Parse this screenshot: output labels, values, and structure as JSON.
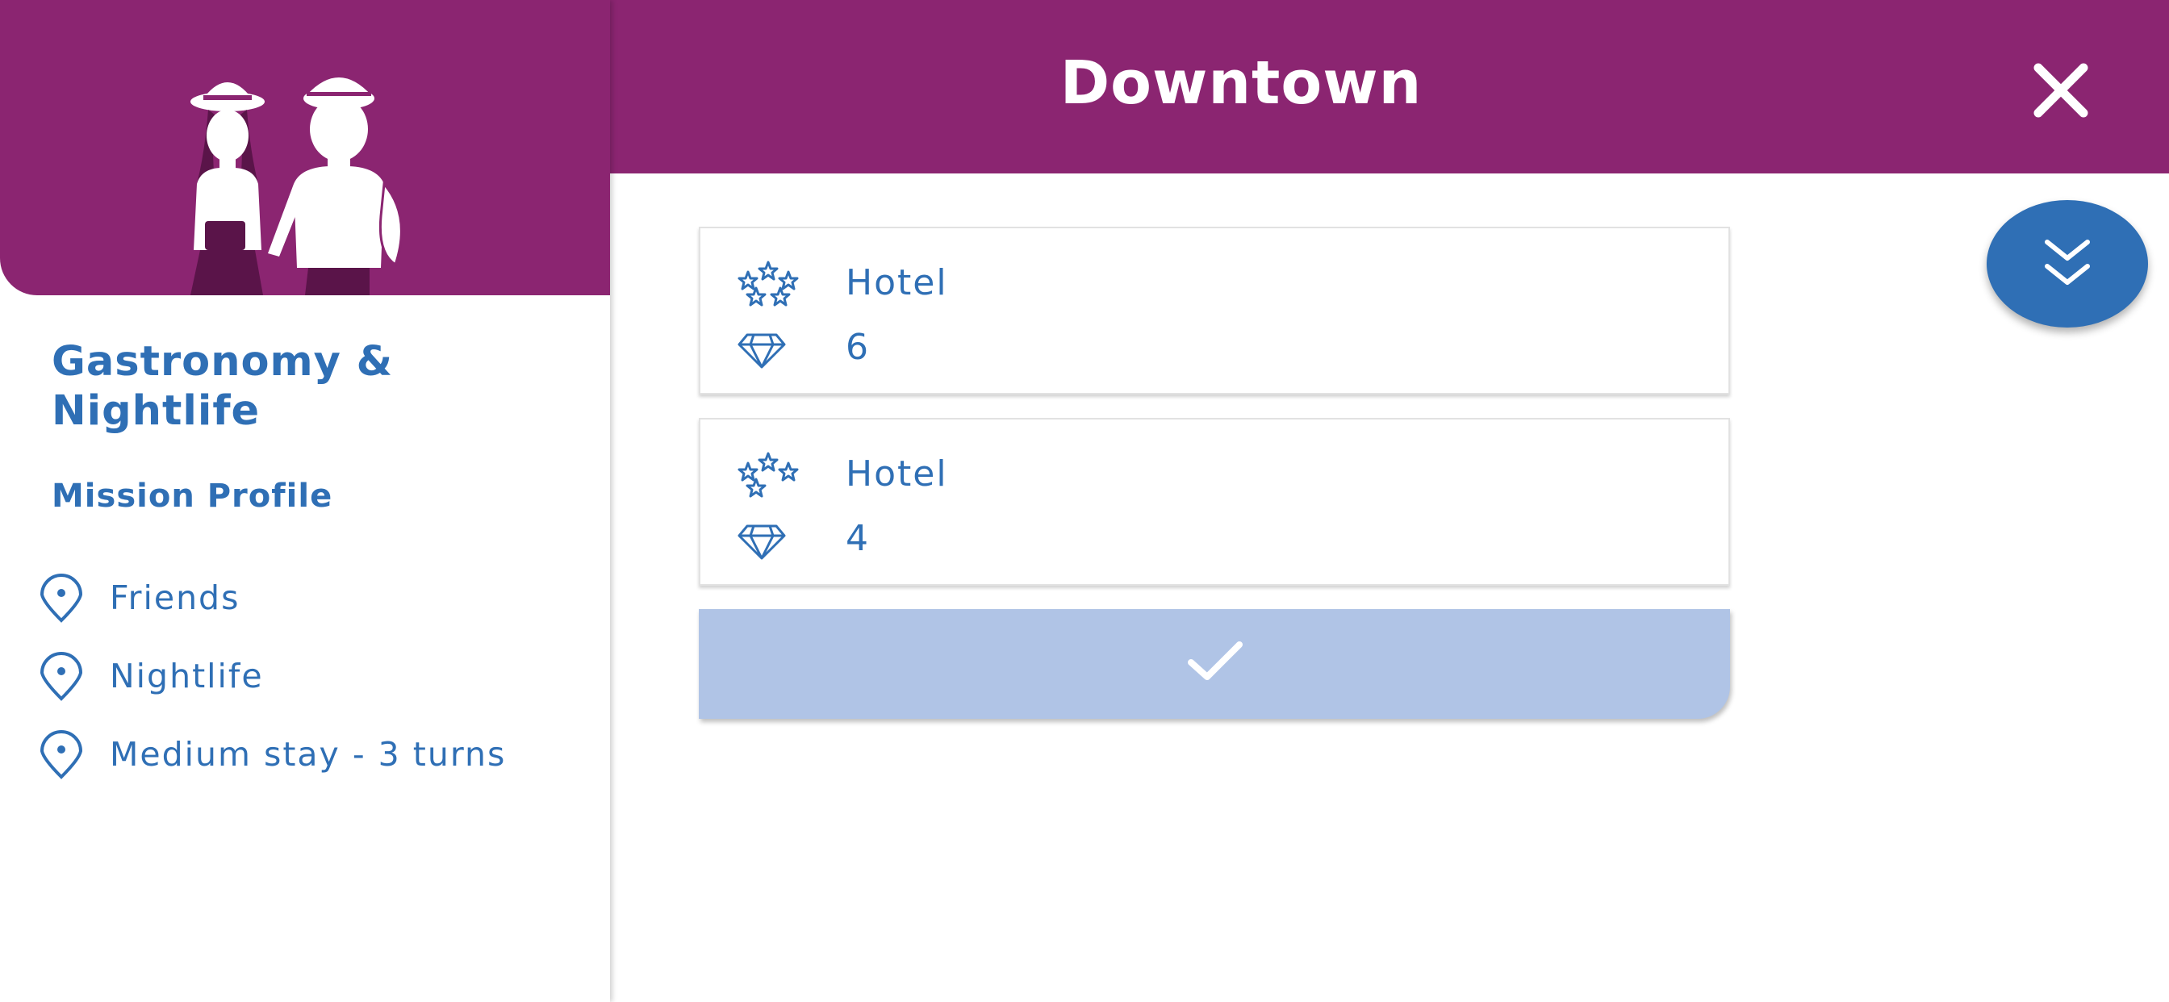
{
  "header": {
    "title": "Downtown"
  },
  "mission": {
    "title": "Gastronomy & Nightlife",
    "section_label": "Mission Profile",
    "profile_items": [
      "Friends",
      "Nightlife",
      "Medium stay - 3 turns"
    ]
  },
  "options": [
    {
      "type": "Hotel",
      "stars": 5,
      "value": "6"
    },
    {
      "type": "Hotel",
      "stars": 4,
      "value": "4"
    }
  ],
  "colors": {
    "header_bg": "#8b2571",
    "accent": "#2f6fb5",
    "confirm_bg": "#b0c4e6",
    "white": "#ffffff"
  },
  "icons": {
    "close": "close-icon",
    "expand": "chevron-double-down-icon",
    "confirm": "checkmark-icon",
    "profile": "map-pin-icon",
    "stars": "star-cluster-icon",
    "value": "diamond-icon"
  }
}
